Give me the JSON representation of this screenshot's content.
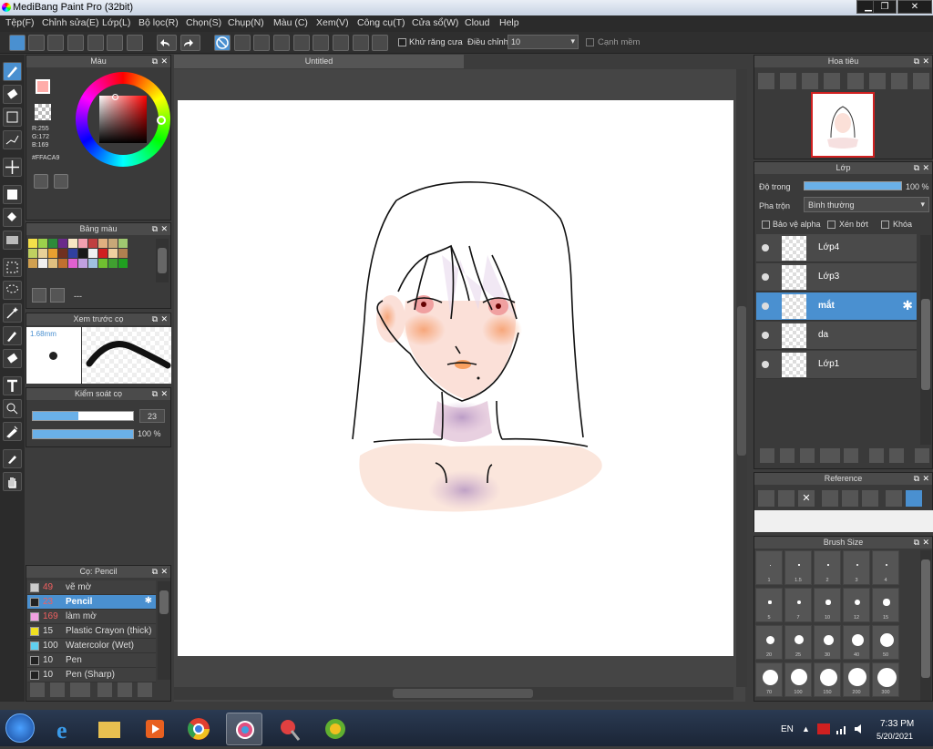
{
  "app": {
    "title": "MediBang Paint Pro (32bit)"
  },
  "menu": [
    "Tệp(F)",
    "Chỉnh sửa(E)",
    "Lớp(L)",
    "Bộ lọc(R)",
    "Chọn(S)",
    "Chụp(N)",
    "Màu (C)",
    "Xem(V)",
    "Công cụ(T)",
    "Cửa sổ(W)",
    "Cloud",
    "Help"
  ],
  "toolbar": {
    "antialias": "Khử răng cưa",
    "adjust": "Điều chỉnh",
    "adjust_value": "10",
    "soft_edge": "Cạnh mềm"
  },
  "document": {
    "tab": "Untitled"
  },
  "color_panel": {
    "title": "Màu",
    "r": "R:255",
    "g": "G:172",
    "b": "B:169",
    "hex": "#FFACA9",
    "fg": "#FFACA9"
  },
  "palette_panel": {
    "title": "Bảng màu",
    "dashes": "---",
    "colors": [
      "#f4e04a",
      "#9bd14b",
      "#2e8a3a",
      "#6a2a8a",
      "#f7e6c4",
      "#f2a0b0",
      "#c04040",
      "#e0b080",
      "#c8a878",
      "#a0c870",
      "#c0d060",
      "#e8d098",
      "#e8a030",
      "#703020",
      "#3040a0",
      "#181818",
      "#f0f0f0",
      "#d02020",
      "#f0d0a0",
      "#b08050",
      "#d0a050",
      "#f0f0f0",
      "#e0c080",
      "#c07030",
      "#e060d0",
      "#c0a0e0",
      "#a0c0e0",
      "#70c030",
      "#40a030",
      "#20a020"
    ]
  },
  "preview_panel": {
    "title": "Xem trước cọ",
    "size": "1.68mm"
  },
  "control_panel": {
    "title": "Kiểm soát cọ",
    "size_value": "23",
    "opacity_value": "100 %",
    "size_fraction": 0.45,
    "opacity_fraction": 1.0
  },
  "brush_panel": {
    "title": "Cọ: Pencil",
    "rows": [
      {
        "size": "49",
        "name": "vẽ mờ",
        "color": "#cccccc"
      },
      {
        "size": "23",
        "name": "Pencil",
        "color": "#222222"
      },
      {
        "size": "169",
        "name": "làm mờ",
        "color": "#f0a0e0"
      },
      {
        "size": "15",
        "name": "Plastic Crayon (thick)",
        "color": "#f0e020"
      },
      {
        "size": "100",
        "name": "Watercolor (Wet)",
        "color": "#60d0f0"
      },
      {
        "size": "10",
        "name": "Pen",
        "color": "#222222"
      },
      {
        "size": "10",
        "name": "Pen (Sharp)",
        "color": "#222222"
      }
    ]
  },
  "navigator_panel": {
    "title": "Hoa tiêu"
  },
  "layer_panel": {
    "title": "Lớp",
    "opacity_label": "Độ trong",
    "opacity_value": "100 %",
    "blend_label": "Pha trộn",
    "blend_value": "Bình thường",
    "protect_alpha": "Bảo vệ alpha",
    "clip": "Xén bớt",
    "lock": "Khóa",
    "layers": [
      {
        "name": "Lớp4"
      },
      {
        "name": "Lớp3"
      },
      {
        "name": "mắt"
      },
      {
        "name": "da"
      },
      {
        "name": "Lớp1"
      }
    ]
  },
  "reference_panel": {
    "title": "Reference"
  },
  "brushsize_panel": {
    "title": "Brush Size",
    "sizes": [
      "1",
      "1.5",
      "2",
      "3",
      "4",
      "5",
      "7",
      "10",
      "12",
      "15",
      "20",
      "25",
      "30",
      "40",
      "50",
      "70",
      "100",
      "150",
      "200",
      "300"
    ]
  },
  "taskbar": {
    "lang": "EN",
    "time": "7:33 PM",
    "date": "5/20/2021"
  }
}
